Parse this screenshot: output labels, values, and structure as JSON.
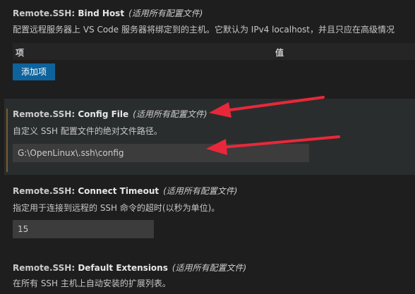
{
  "settings": {
    "bind_host": {
      "prefix": "Remote.SSH: ",
      "name": "Bind Host",
      "scope": "(适用所有配置文件)",
      "description": "配置远程服务器上 VS Code 服务器将绑定到的主机。它默认为 IPv4 localhost，并且只应在高级情况",
      "column_item": "项",
      "column_value": "值",
      "add_button": "添加项"
    },
    "config_file": {
      "prefix": "Remote.SSH: ",
      "name": "Config File",
      "scope": "(适用所有配置文件)",
      "description": "自定义 SSH 配置文件的绝对文件路径。",
      "value": "G:\\OpenLinux\\.ssh\\config"
    },
    "connect_timeout": {
      "prefix": "Remote.SSH: ",
      "name": "Connect Timeout",
      "scope": "(适用所有配置文件)",
      "description": "指定用于连接到远程的 SSH 命令的超时(以秒为单位)。",
      "value": "15"
    },
    "default_extensions": {
      "prefix": "Remote.SSH: ",
      "name": "Default Extensions",
      "scope": "(适用所有配置文件)",
      "description": "在所有 SSH 主机上自动安装的扩展列表。"
    }
  },
  "colors": {
    "background": "#1e1e1e",
    "button": "#0e639c",
    "input": "#3c3c3c",
    "annotation_arrow": "#e8283a",
    "focus_bar": "#7a5b2f"
  }
}
